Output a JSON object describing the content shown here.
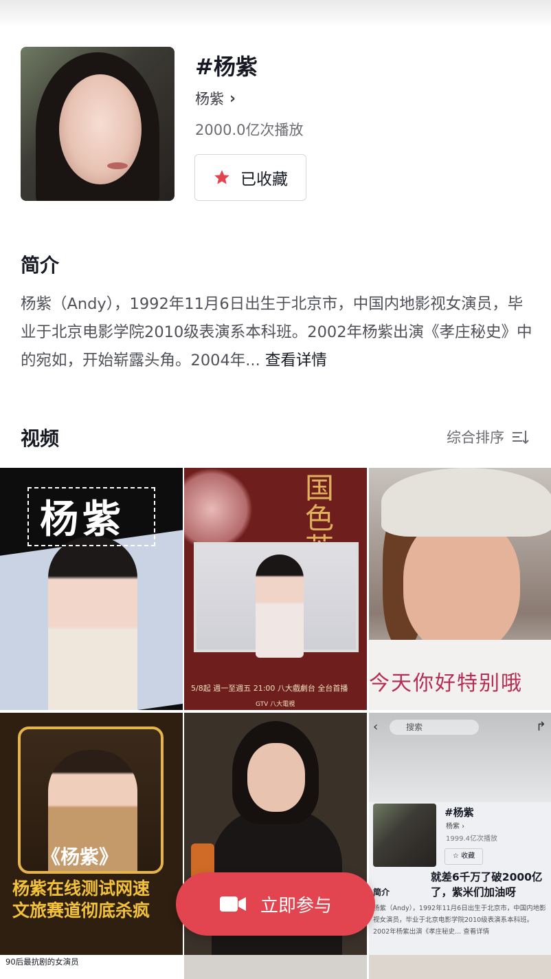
{
  "topic": {
    "title": "#杨紫",
    "creator": "杨紫",
    "plays": "2000.0亿次播放",
    "favorite_label": "已收藏"
  },
  "intro": {
    "heading": "简介",
    "text": "杨紫（Andy），1992年11月6日出生于北京市，中国内地影视女演员，毕业于北京电影学院2010级表演系本科班。2002年杨紫出演《孝庄秘史》中的宛如，开始崭露头角。2004年...",
    "more_label": "查看详情"
  },
  "videos": {
    "heading": "视频",
    "sort_label": "综合排序",
    "tiles": [
      {
        "overlay": "杨紫"
      },
      {
        "overlay": "国色芳华",
        "line1": "5/8起 週一至週五 21:00 八大戲劇台 全台首播",
        "line2": "GTV 八大電視"
      },
      {
        "overlay": "今天你好特别哦"
      },
      {
        "overlay_line0": "《杨紫》",
        "overlay_line1": "杨紫在线测试网速",
        "overlay_line2": "文旅赛道彻底杀疯"
      },
      {
        "overlay": ""
      },
      {
        "search_label": "搜索",
        "title": "#杨紫",
        "creator": "杨紫 ›",
        "plays": "1999.4亿次播放",
        "fav": "收藏",
        "caption": "就差6千万了破2000亿了，紫米们加油呀",
        "intro_heading": "简介",
        "intro_text": "杨紫（Andy），1992年11月6日出生于北京市，中国内地影视女演员，毕业于北京电影学院2010级表演系本科班。2002年杨紫出演《孝庄秘史...",
        "more": "查看详情"
      }
    ],
    "peek": [
      {
        "caption": "90后最抗剧的女演员"
      }
    ]
  },
  "join_button": {
    "label": "立即参与"
  },
  "colors": {
    "accent": "#e2454f",
    "text": "#161823",
    "muted": "#6b6c73"
  }
}
